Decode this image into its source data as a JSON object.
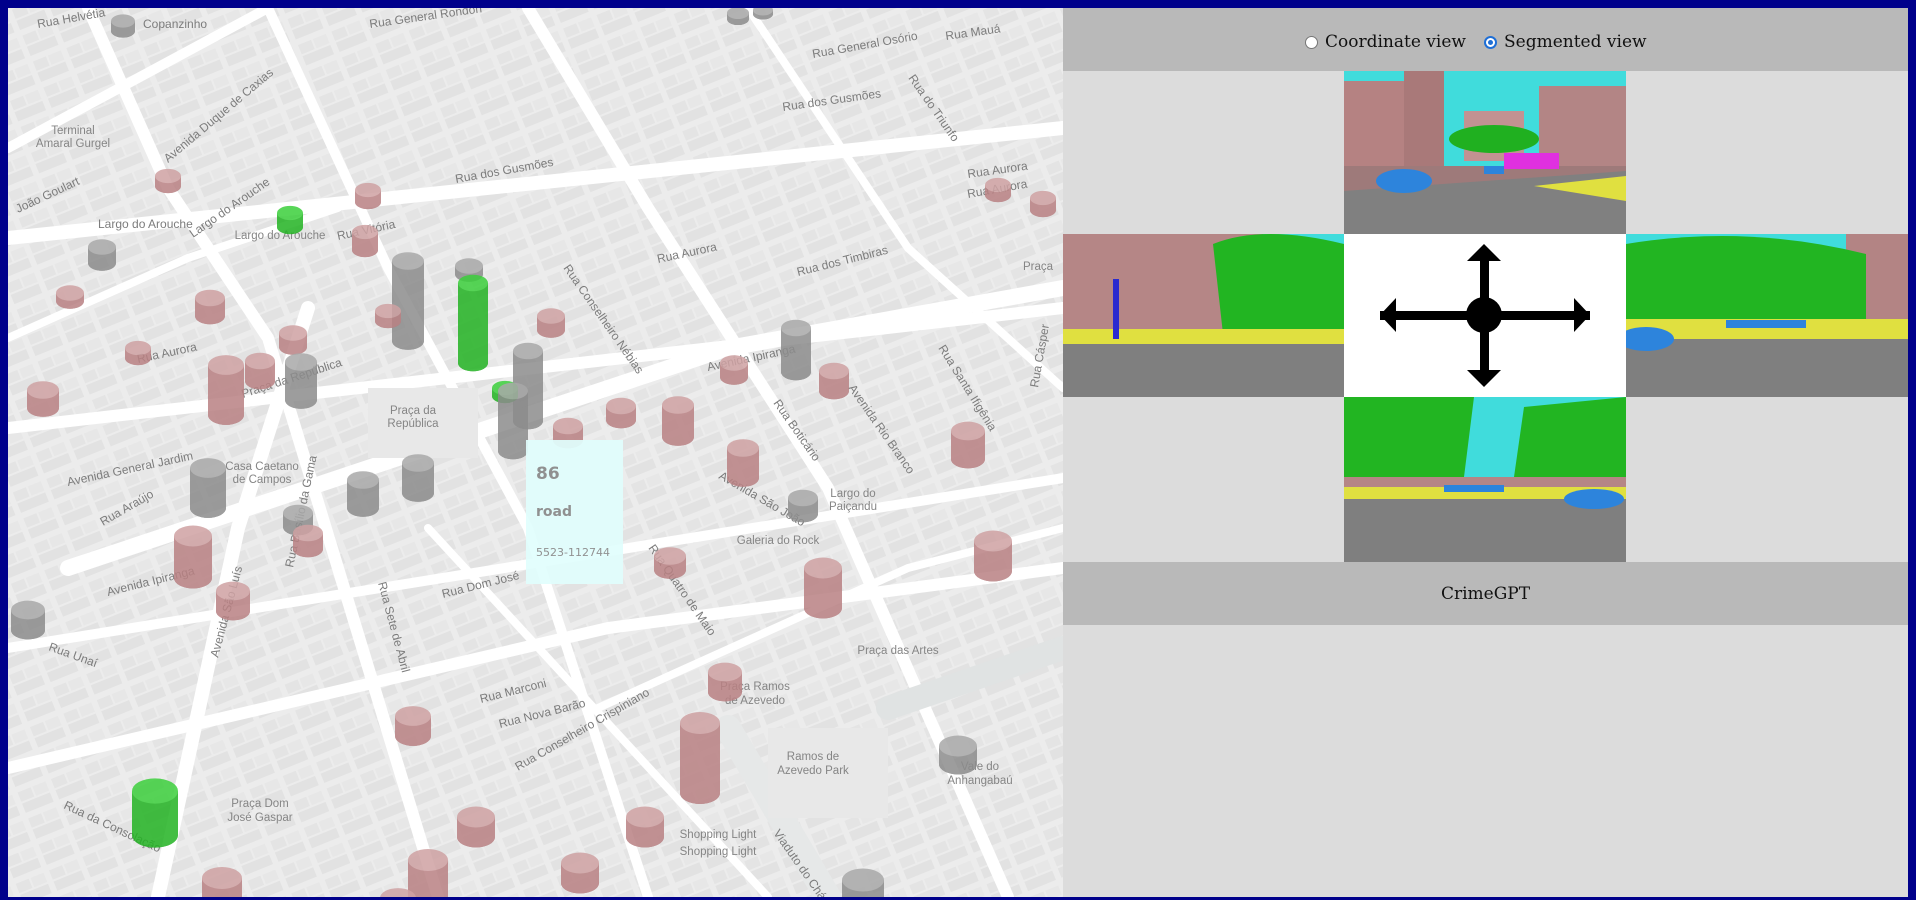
{
  "map": {
    "streets": [
      {
        "text": "Rua Helvétia"
      },
      {
        "text": "Copanzinho"
      },
      {
        "text": "Rua General Rondon"
      },
      {
        "text": "Rua Mauá"
      },
      {
        "text": "Rua General Osório"
      },
      {
        "text": "Rua do Triunfo"
      },
      {
        "text": "Rua dos Gusmões"
      },
      {
        "text": "Avenida Duque de Caxias"
      },
      {
        "text": "Rua dos Gusmões"
      },
      {
        "text": "Largo do Arouche"
      },
      {
        "text": "Rua Aurora"
      },
      {
        "text": "Rua Vitória"
      },
      {
        "text": "Rua Aurora"
      },
      {
        "text": "Rua dos Timbiras"
      },
      {
        "text": "Rua Conselheiro Nébias"
      },
      {
        "text": "Rua Santa Ifigênia"
      },
      {
        "text": "Rua Aurora"
      },
      {
        "text": "Praça da República"
      },
      {
        "text": "Avenida Ipiranga"
      },
      {
        "text": "Avenida Rio Branco"
      },
      {
        "text": "Rua Boticário"
      },
      {
        "text": "Avenida São João"
      },
      {
        "text": "Avenida General Jardim"
      },
      {
        "text": "Rua Araújo"
      },
      {
        "text": "Avenida Ipiranga"
      },
      {
        "text": "Rua Basílio da Gama"
      },
      {
        "text": "Rua Sete de Abril"
      },
      {
        "text": "Rua Dom José"
      },
      {
        "text": "Rua Quatro de Maio"
      },
      {
        "text": "Avenida São Luís"
      },
      {
        "text": "Rua Unaí"
      },
      {
        "text": "Rua Marconi"
      },
      {
        "text": "Rua Nova Barão"
      },
      {
        "text": "Rua Conselheiro Crispiniano"
      },
      {
        "text": "Rua da Consolação"
      },
      {
        "text": "Viaduto do Chá"
      },
      {
        "text": "Rua Cásper"
      },
      {
        "text": "Largo do Arouche"
      },
      {
        "text": "João Goulart"
      },
      {
        "text": "Rua Aurora"
      }
    ],
    "places": [
      {
        "text": "Terminal"
      },
      {
        "text": "Amaral Gurgel"
      },
      {
        "text": "Largo do Arouche"
      },
      {
        "text": "Praça da"
      },
      {
        "text": "República"
      },
      {
        "text": "Casa Caetano"
      },
      {
        "text": "de Campos"
      },
      {
        "text": "Largo do"
      },
      {
        "text": "Paiçandu"
      },
      {
        "text": "Galeria do Rock"
      },
      {
        "text": "Praça das Artes"
      },
      {
        "text": "Praça Ramos"
      },
      {
        "text": "de Azevedo"
      },
      {
        "text": "Ramos de"
      },
      {
        "text": "Azevedo Park"
      },
      {
        "text": "Vale do"
      },
      {
        "text": "Anhangabaú"
      },
      {
        "text": "Praça Dom"
      },
      {
        "text": "José Gaspar"
      },
      {
        "text": "Shopping Light"
      },
      {
        "text": "Shopping Light"
      },
      {
        "text": "Praça"
      }
    ],
    "colors": {
      "brown": "#b98183",
      "gray": "#8c8c8c",
      "green": "#23b323"
    },
    "tooltip": {
      "value": "86",
      "category": "road",
      "id": "5523-112744"
    }
  },
  "controls": {
    "coordinate_label": "Coordinate view",
    "segmented_label": "Segmented view",
    "selected": "segmented"
  },
  "camera_views": {
    "top": "front-camera-segmented",
    "left": "left-camera-segmented",
    "center": "navigation-arrows-icon",
    "right": "right-camera-segmented",
    "bottom": "rear-camera-segmented"
  },
  "footer": {
    "label": "CrimeGPT"
  }
}
